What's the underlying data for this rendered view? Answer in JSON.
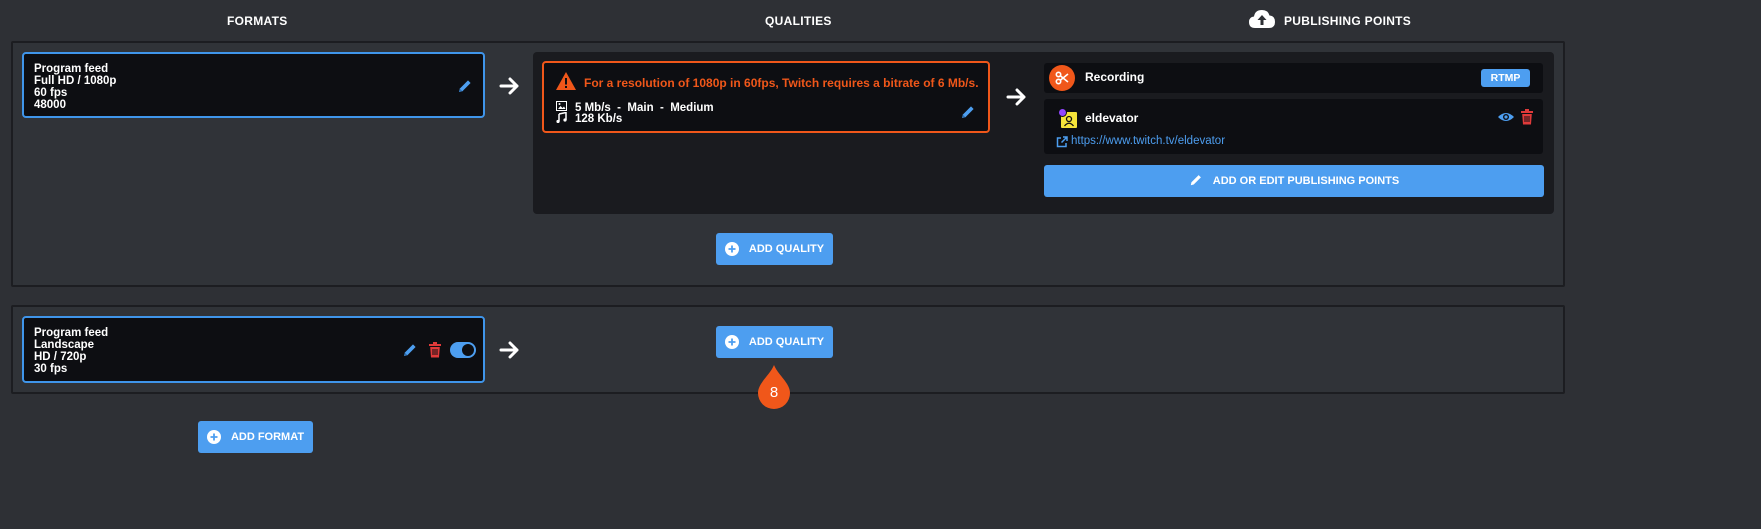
{
  "header": {
    "formats": "FORMATS",
    "qualities": "QUALITIES",
    "publishing_points": "PUBLISHING POINTS"
  },
  "format1": {
    "line1": "Program feed",
    "line2": "Full HD / 1080p",
    "line3": "60 fps",
    "line4": "48000"
  },
  "quality1": {
    "warning": "For a resolution of 1080p in 60fps, Twitch requires a bitrate of 6 Mb/s.",
    "video": "5 Mb/s  -  Main  -  Medium",
    "audio": "128 Kb/s"
  },
  "publishing": {
    "recording_label": "Recording",
    "recording_tag": "RTMP",
    "channel_name": "eldevator",
    "channel_url": "https://www.twitch.tv/eldevator",
    "edit_button": "ADD OR EDIT PUBLISHING POINTS"
  },
  "add_quality_label": "ADD QUALITY",
  "format2": {
    "line1": "Program feed",
    "line2": "Landscape",
    "line3": "HD / 720p",
    "line4": "30 fps",
    "toggle_on": true
  },
  "add_format_label": "ADD FORMAT",
  "step_marker": "8",
  "colors": {
    "accent": "#4d9ef0",
    "warning": "#f0571a",
    "danger": "#e03a3a",
    "background": "#2e3035"
  }
}
